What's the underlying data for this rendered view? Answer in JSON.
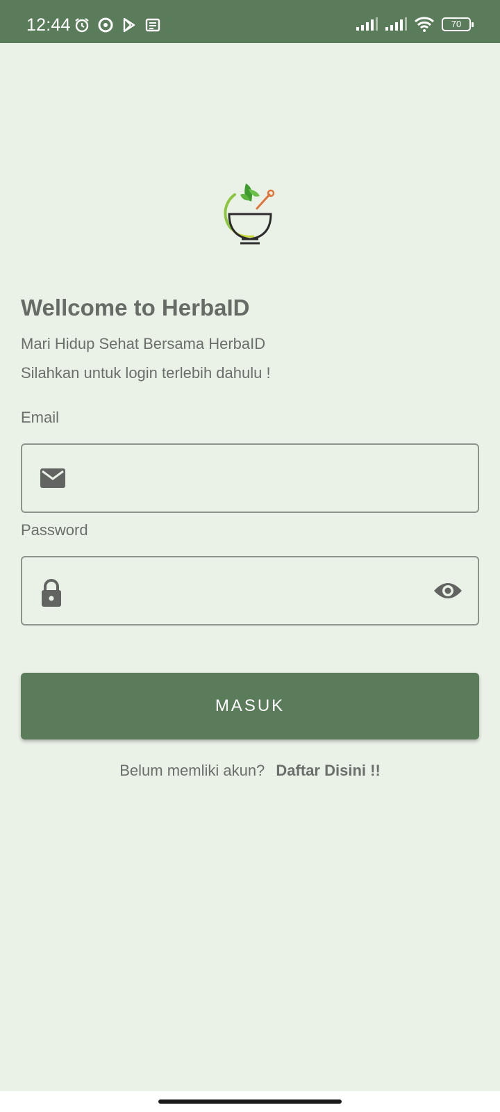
{
  "status_bar": {
    "time": "12:44",
    "battery": "70",
    "left_icons": [
      "alarm-icon",
      "circle-app-icon",
      "play-store-icon",
      "news-icon"
    ],
    "right_icons": [
      "signal-icon",
      "signal-icon",
      "wifi-icon",
      "battery-icon"
    ]
  },
  "login": {
    "title": "Wellcome to HerbaID",
    "subtitle_1": "Mari Hidup Sehat Bersama HerbaID",
    "subtitle_2": "Silahkan untuk login terlebih dahulu !",
    "email_label": "Email",
    "email_value": "",
    "password_label": "Password",
    "password_value": "",
    "submit_label": "MASUK",
    "register_prompt": "Belum memliki akun?",
    "register_link": "Daftar Disini !!"
  },
  "colors": {
    "primary": "#5A7C5A",
    "background": "#EAF1E7",
    "text": "#6B6F6B"
  }
}
